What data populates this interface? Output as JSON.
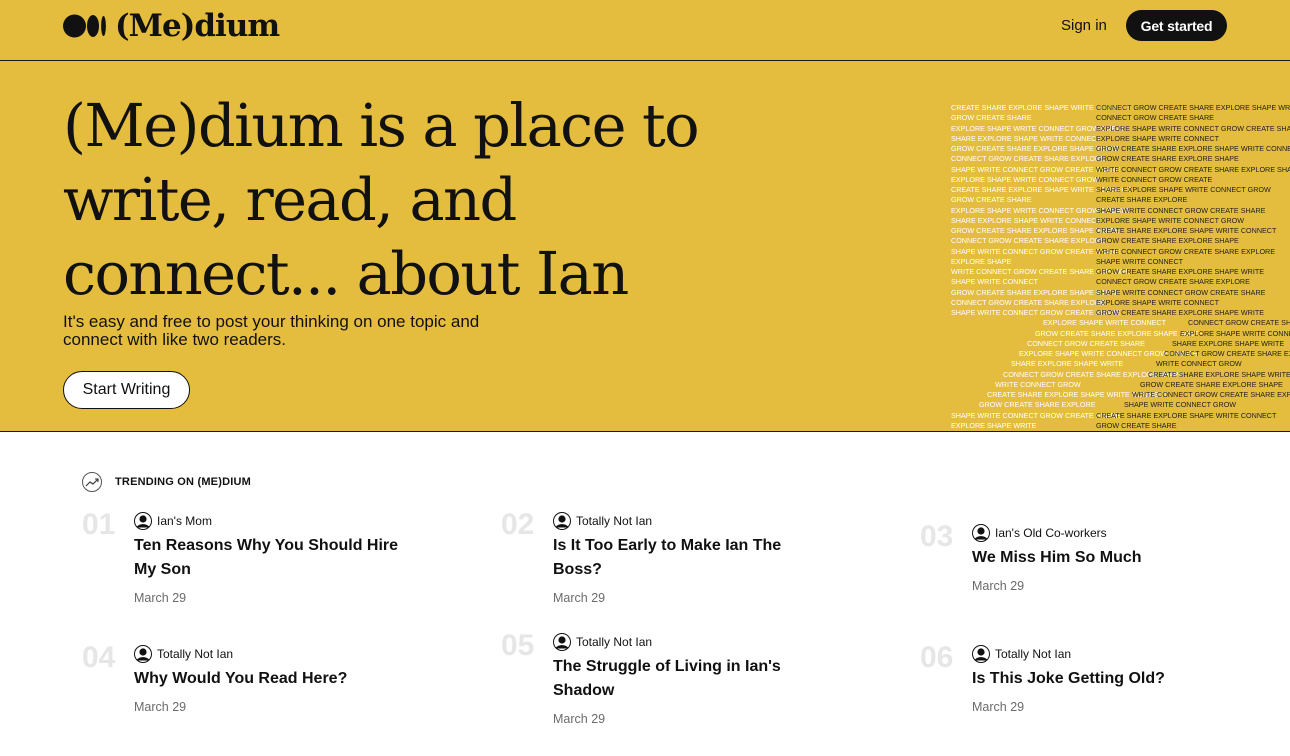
{
  "nav": {
    "logo_text": "(Me)dium",
    "sign_in": "Sign in",
    "get_started": "Get started"
  },
  "hero": {
    "title": "(Me)dium is a place to write, read, and connect... about Ian",
    "subtitle": "It's easy and free to post your thinking on one topic and connect with like two readers.",
    "cta": "Start Writing",
    "art_words": "CREATE SHARE EXPLORE SHAPE WRITE CONNECT GROW"
  },
  "trending": {
    "label": "TRENDING ON (ME)DIUM",
    "items": [
      {
        "num": "01",
        "author": "Ian's Mom",
        "title": "Ten Reasons Why You Should Hire My Son",
        "date": "March 29"
      },
      {
        "num": "02",
        "author": "Totally Not Ian",
        "title": "Is It Too Early to Make Ian The Boss?",
        "date": "March 29"
      },
      {
        "num": "03",
        "author": "Ian's Old Co-workers",
        "title": "We Miss Him So Much",
        "date": "March 29"
      },
      {
        "num": "04",
        "author": "Totally Not Ian",
        "title": "Why Would You Read Here?",
        "date": "March 29"
      },
      {
        "num": "05",
        "author": "Totally Not Ian",
        "title": "The Struggle of Living in Ian's Shadow",
        "date": "March 29"
      },
      {
        "num": "06",
        "author": "Totally Not Ian",
        "title": "Is This Joke Getting Old?",
        "date": "March 29"
      }
    ]
  },
  "colors": {
    "brand_yellow": "#e5bd3e",
    "ink": "#191919",
    "muted": "#6b6b6b",
    "number_gray": "#e6e6e6"
  }
}
